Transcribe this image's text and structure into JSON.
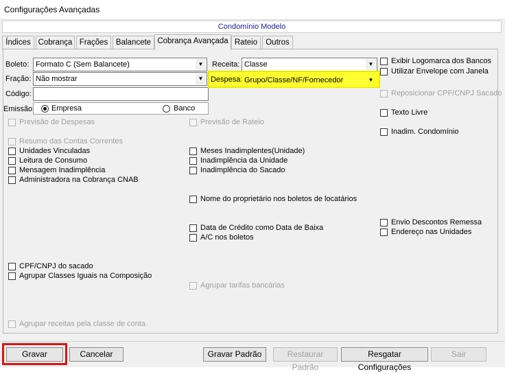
{
  "window": {
    "title": "Configurações Avançadas"
  },
  "header": {
    "subtitle": "Condomínio Modelo"
  },
  "tabs": [
    {
      "label": "Índices"
    },
    {
      "label": "Cobrança"
    },
    {
      "label": "Frações"
    },
    {
      "label": "Balancete"
    },
    {
      "label": "Cobrança Avançada"
    },
    {
      "label": "Rateio"
    },
    {
      "label": "Outros"
    }
  ],
  "form": {
    "boleto_label": "Boleto:",
    "boleto_value": "Formato C (Sem Balancete)",
    "fracao_label": "Fração:",
    "fracao_value": "Não mostrar",
    "codigo_label": "Código:",
    "codigo_value": "",
    "emissao_label": "Emissão:",
    "emissao_empresa": "Empresa",
    "emissao_banco": "Banco",
    "receita_label": "Receita:",
    "receita_value": "Classe",
    "despesa_label": "Despesa:",
    "despesa_value": "Grupo/Classe/NF/Fornecedor"
  },
  "checkboxes": {
    "previsao_despesas": "Previsão de Despesas",
    "previsao_rateio": "Previsão de Rateio",
    "resumo_contas": "Resumo das Contas Correntes",
    "unidades_vinculadas": "Unidades Vinculadas",
    "leitura_consumo": "Leitura de Consumo",
    "mensagem_inadimplencia": "Mensagem Inadimplência",
    "administradora_cnab": "Administradora na Cobrança CNAB",
    "meses_inadimplentes": "Meses Inadimplentes(Unidade)",
    "inadimplencia_unidade": "Inadimplência da Unidade",
    "inadimplencia_sacado": "Inadimplência do Sacado",
    "nome_proprietario": "Nome do proprietário nos boletos de locatários",
    "data_credito": "Data de Crédito como Data de Baixa",
    "ac_boletos": "A/C nos boletos",
    "cpf_cnpj_sacado": "CPF/CNPJ do sacado",
    "agrupar_classes": "Agrupar Classes Iguais na Composição",
    "agrupar_tarifas": "Agrupar tarifas bancárias",
    "agrupar_receitas": "Agrupar receitas pela classe de conta",
    "exibir_logomarca": "Exibir Logomarca dos Bancos",
    "utilizar_envelope": "Utilizar Envelope com Janela",
    "reposicionar_cpf": "Reposicionar CPF/CNPJ Sacado",
    "texto_livre": "Texto Livre",
    "inadim_condominio": "Inadim. Condomínio",
    "envio_descontos": "Envio Descontos Remessa",
    "endereco_unidades": "Endereço nas Unidades"
  },
  "buttons": {
    "gravar": "Gravar",
    "cancelar": "Cancelar",
    "gravar_padrao": "Gravar Padrão",
    "restaurar_padrao": "Restaurar Padrão",
    "resgatar_configuracoes": "Resgatar Configurações",
    "sair": "Sair"
  },
  "colors": {
    "highlight": "#ffff33",
    "focus_box": "#e01010",
    "subtitle": "#1b1b9a"
  }
}
